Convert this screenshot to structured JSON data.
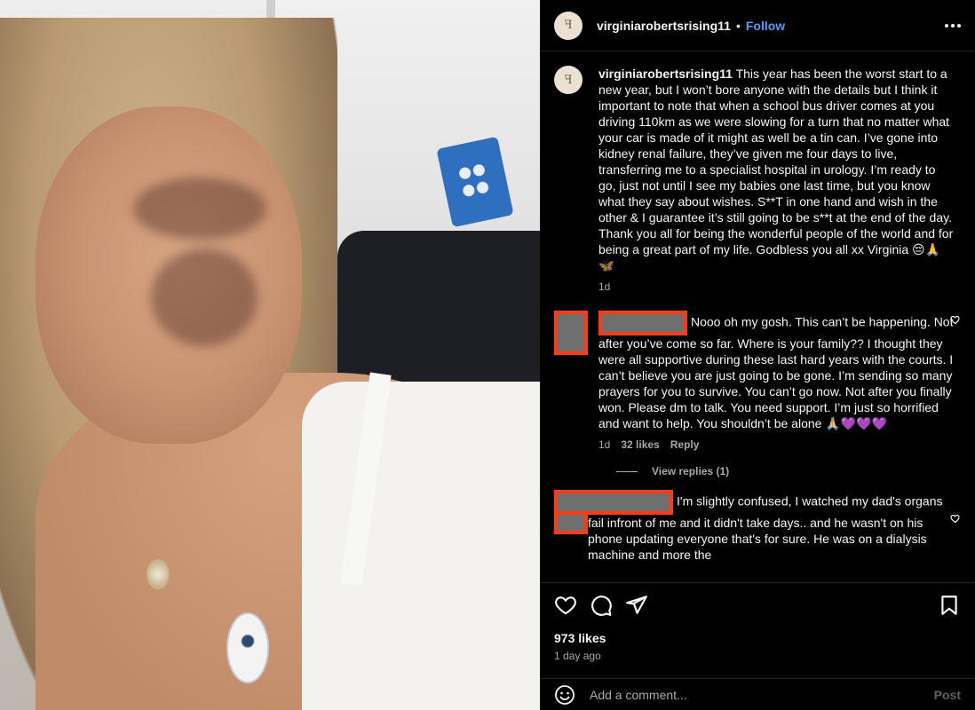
{
  "header": {
    "username": "virginiaroberts­rising11",
    "separator": "•",
    "follow_label": "Follow",
    "avatar_glyph": "ꟻ"
  },
  "caption": {
    "username": "virginiarobertsrising11",
    "text": "This year has been the worst start to a new year, but I won’t bore anyone with the details but I think it important to note that when a school bus driver comes at you driving 110km as we were slowing for a turn that no matter what your car is made of it might as well be a tin can. I’ve gone into kidney renal failure, they’ve given me four days to live, transferring me to a specialist hospital in urology. I’m ready to go, just not until I see my babies one last time, but you know what they say about wishes. S**T in one hand and wish in the other & I guarantee it’s still going to be s**t at the end of the day. Thank you all for being the wonderful people of the world and for being a great part of my life. Godbless you all xx Virginia 😔🙏🦋",
    "age": "1d"
  },
  "comments": [
    {
      "text": "Nooo oh my gosh. This can’t be happening. Not after you’ve come so far. Where is your family?? I thought they were all supportive during these last hard years with the courts. I can’t believe you are just going to be gone. I’m sending so many prayers for you to survive. You can’t go now. Not after you finally won. Please dm to talk. You need support. I’m just so horrified and want to help. You shouldn’t be alone 🙏🏼💜💜💜",
      "age": "1d",
      "likes": "32 likes",
      "reply_label": "Reply",
      "view_replies": "View replies (1)"
    },
    {
      "text": "I'm slightly confused, I watched my dad's organs fail infront of me and it didn't take days.. and he wasn't on his phone updating everyone that's for sure. He was on a dialysis machine and more the"
    }
  ],
  "stats": {
    "likes": "973 likes",
    "time": "1 day ago"
  },
  "add_comment": {
    "placeholder": "Add a comment...",
    "post_label": "Post"
  },
  "colors": {
    "follow": "#4f9cf9",
    "redaction_border": "#ff3b12",
    "redaction_fill": "#6f6f6f",
    "muted": "#a8a8a8"
  }
}
